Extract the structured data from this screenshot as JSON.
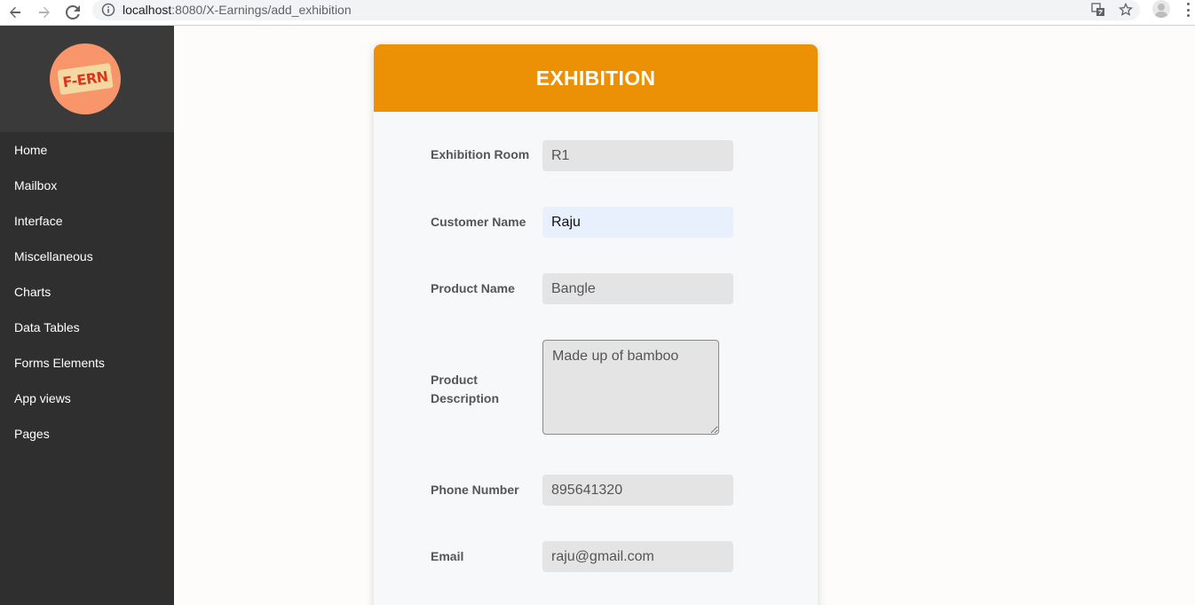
{
  "browser": {
    "url_host": "localhost",
    "url_path": ":8080/X-Earnings/add_exhibition"
  },
  "sidebar": {
    "logo_text": "F-ERN",
    "items": [
      {
        "label": "Home"
      },
      {
        "label": "Mailbox"
      },
      {
        "label": "Interface"
      },
      {
        "label": "Miscellaneous"
      },
      {
        "label": "Charts"
      },
      {
        "label": "Data Tables"
      },
      {
        "label": "Forms Elements"
      },
      {
        "label": "App views"
      },
      {
        "label": "Pages"
      }
    ]
  },
  "form": {
    "title": "EXHIBITION",
    "exhibition_room": {
      "label": "Exhibition Room",
      "value": "R1"
    },
    "customer_name": {
      "label": "Customer Name",
      "value": "Raju"
    },
    "product_name": {
      "label": "Product Name",
      "value": "Bangle"
    },
    "product_description": {
      "label_line1": "Product",
      "label_line2": "Description",
      "value": "Made up of bamboo"
    },
    "phone_number": {
      "label": "Phone Number",
      "value": "895641320"
    },
    "email": {
      "label": "Email",
      "value": "raju@gmail.com"
    }
  },
  "colors": {
    "header_accent": "#ec9006",
    "sidebar_bg": "#2f2f2f",
    "logo_bg": "#f9956a"
  }
}
